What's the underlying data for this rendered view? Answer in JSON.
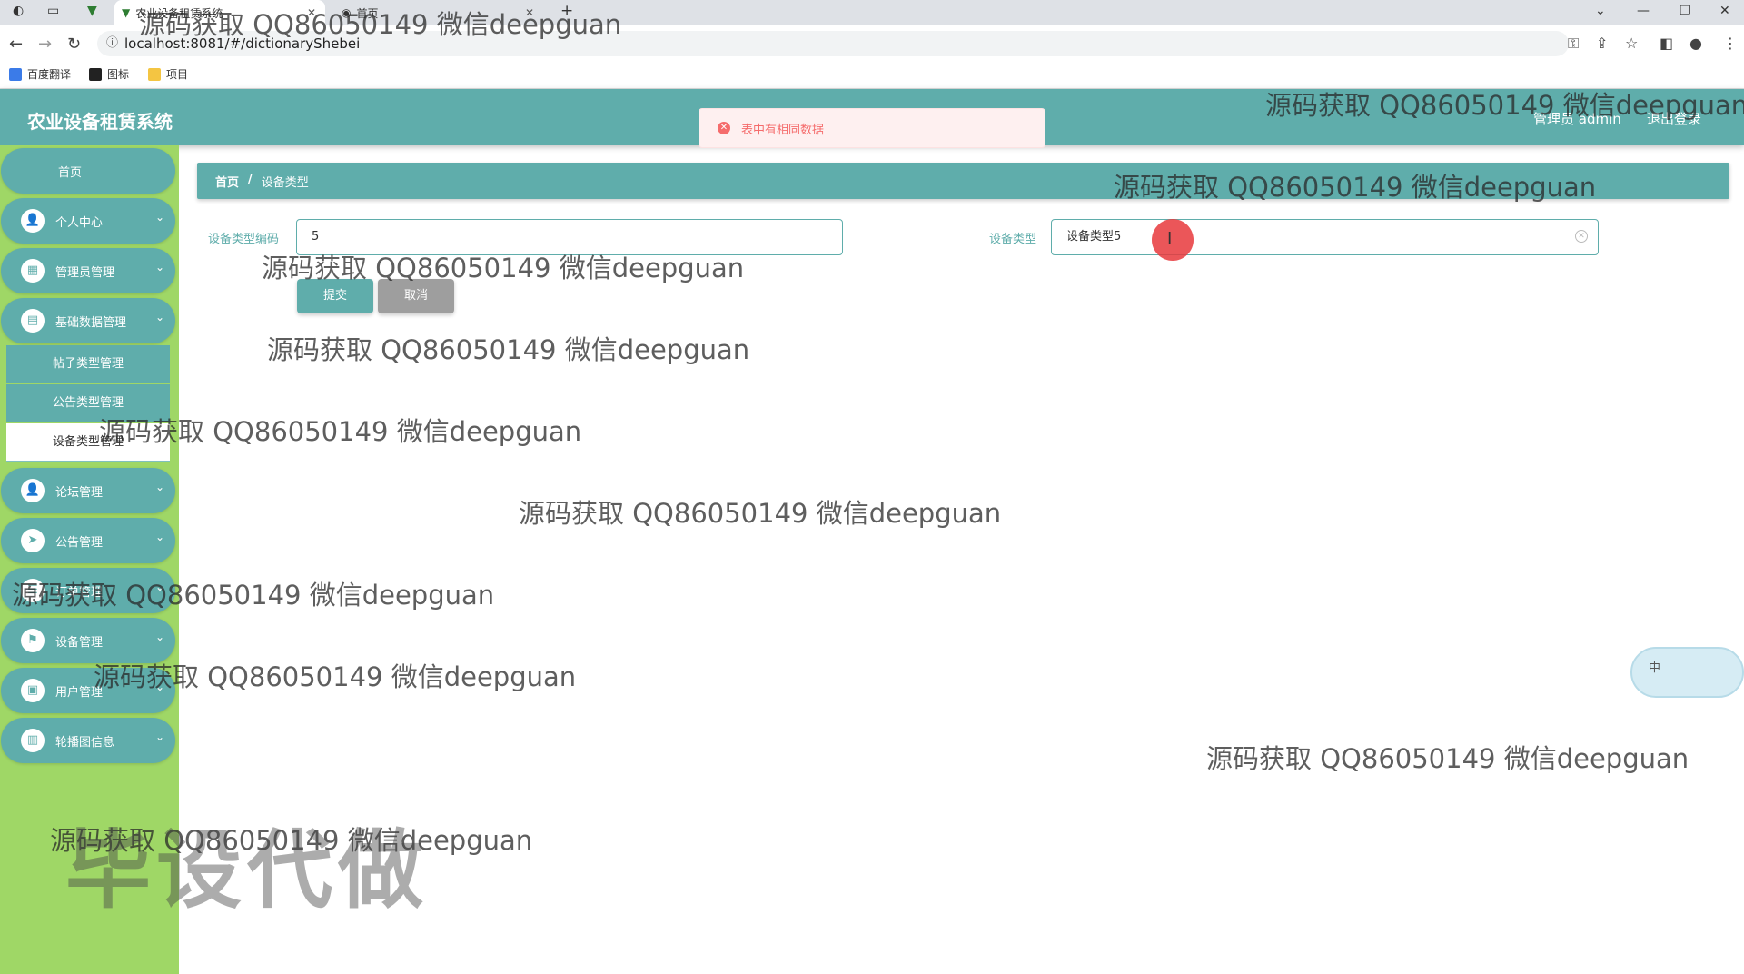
{
  "browser": {
    "tabs": [
      {
        "label": "农业设备租赁系统",
        "active": true
      },
      {
        "label": "首页",
        "active": false
      }
    ],
    "new_tab": "+",
    "url": "localhost:8081/#/dictionaryShebei",
    "bookmarks": [
      "百度翻译",
      "图标",
      "项目"
    ]
  },
  "app": {
    "title": "农业设备租赁系统",
    "user_label": "管理员 admin",
    "logout_label": "退出登录"
  },
  "toast": {
    "message": "表中有相同数据",
    "type": "error",
    "color": "#f56c6c"
  },
  "sidebar": {
    "items": [
      {
        "label": "首页",
        "icon": ""
      },
      {
        "label": "个人中心",
        "icon": "user-icon"
      },
      {
        "label": "管理员管理",
        "icon": "grid-icon"
      },
      {
        "label": "基础数据管理",
        "icon": "chart-icon"
      },
      {
        "label": "论坛管理",
        "icon": "user-icon"
      },
      {
        "label": "公告管理",
        "icon": "send-icon"
      },
      {
        "label": "订单管理",
        "icon": "list-icon"
      },
      {
        "label": "设备管理",
        "icon": "flag-icon"
      },
      {
        "label": "用户管理",
        "icon": "briefcase-icon"
      },
      {
        "label": "轮播图信息",
        "icon": "clipboard-icon"
      }
    ],
    "subitems": [
      {
        "label": "帖子类型管理",
        "active": false
      },
      {
        "label": "公告类型管理",
        "active": false
      },
      {
        "label": "设备类型管理",
        "active": true
      }
    ]
  },
  "breadcrumb": {
    "home": "首页",
    "separator": "/",
    "current": "设备类型"
  },
  "form": {
    "code_label": "设备类型编码",
    "code_value": "5",
    "type_label": "设备类型",
    "type_value": "设备类型5",
    "submit_label": "提交",
    "cancel_label": "取消"
  },
  "widget": {
    "text": "中"
  },
  "watermark": {
    "text": "源码获取 QQ86050149 微信deepguan",
    "stamp": "毕设代做"
  },
  "colors": {
    "primary": "#5fadab",
    "sidebar_bg": "#9fd766",
    "error": "#f56c6c"
  }
}
